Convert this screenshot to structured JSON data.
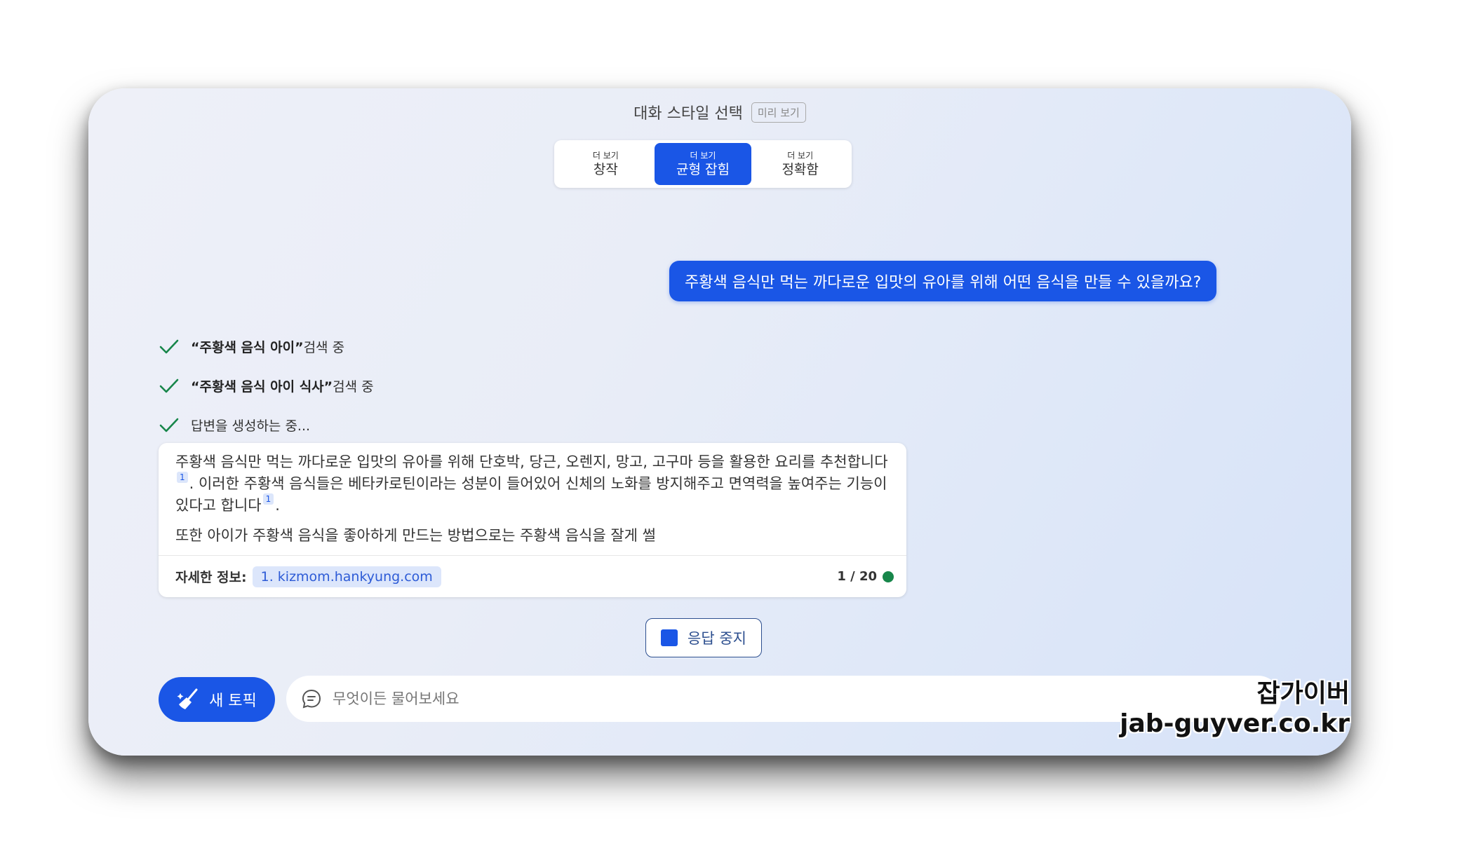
{
  "style_selector": {
    "title": "대화 스타일 선택",
    "preview_tag": "미리 보기",
    "options": [
      {
        "sub": "더 보기",
        "label": "창작",
        "active": false
      },
      {
        "sub": "더 보기",
        "label": "균형 잡힘",
        "active": true
      },
      {
        "sub": "더 보기",
        "label": "정확함",
        "active": false
      }
    ]
  },
  "user_message": "주황색 음식만 먹는 까다로운 입맛의 유아를 위해 어떤 음식을 만들 수 있을까요?",
  "steps": [
    {
      "bold": "“주황색 음식 아이”",
      "text": " 검색 중"
    },
    {
      "bold": "“주황색 음식 아이 식사”",
      "text": " 검색 중"
    },
    {
      "bold": "",
      "text": "답변을 생성하는 중..."
    }
  ],
  "answer": {
    "p1_a": "주황색 음식만 먹는 까다로운 입맛의 유아를 위해 단호박, 당근, 오렌지, 망고, 고구마 등을 활용한 요리를 추천합니다",
    "cite1": "1",
    "p1_b": ". 이러한 주황색 음식들은 베타카로틴이라는 성분이 들어있어 신체의 노화를 방지해주고 면역력을 높여주는 기능이 있다고 합니다",
    "cite2": "1",
    "p1_c": ".",
    "p2": "또한 아이가 주황색 음식을 좋아하게 만드는 방법으로는 주황색 음식을 잘게 썰",
    "more_label": "자세한 정보:",
    "source": "1. kizmom.hankyung.com",
    "counter": "1 / 20"
  },
  "stop_button": "응답 중지",
  "new_topic_button": "새 토픽",
  "input": {
    "placeholder": "무엇이든 물어보세요",
    "value": ""
  },
  "watermark": {
    "line1": "잡가이버",
    "line2": "jab-guyver.co.kr"
  },
  "colors": {
    "accent": "#1a56e6",
    "check": "#17864a",
    "status_dot": "#17864a"
  }
}
